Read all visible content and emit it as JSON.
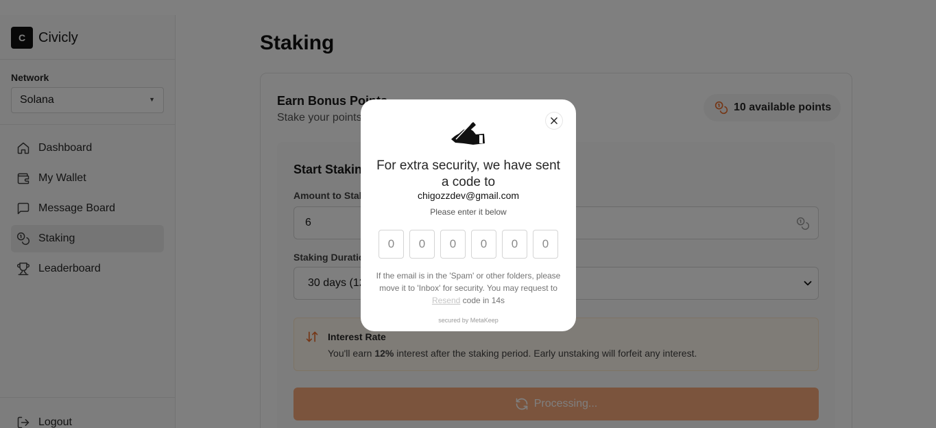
{
  "brand": {
    "logo_letter": "C",
    "name": "Civicly"
  },
  "network": {
    "label": "Network",
    "selected": "Solana"
  },
  "nav": {
    "items": [
      {
        "label": "Dashboard",
        "icon": "home-icon"
      },
      {
        "label": "My Wallet",
        "icon": "wallet-icon"
      },
      {
        "label": "Message Board",
        "icon": "message-icon"
      },
      {
        "label": "Staking",
        "icon": "coins-icon",
        "active": true
      },
      {
        "label": "Leaderboard",
        "icon": "trophy-icon"
      }
    ],
    "logout_label": "Logout"
  },
  "page": {
    "title": "Staking"
  },
  "card": {
    "title": "Earn Bonus Points",
    "subtitle": "Stake your points",
    "points_pill": "10 available points"
  },
  "staking_form": {
    "title": "Start Staking",
    "amount_label": "Amount to Stake",
    "amount_value": "6",
    "duration_label": "Staking Duration",
    "duration_value": "30 days (12",
    "interest_title": "Interest Rate",
    "interest_prefix": "You'll earn ",
    "interest_rate": "12%",
    "interest_suffix": " interest after the staking period. Early unstaking will forfeit any interest.",
    "button_label": "Processing..."
  },
  "modal": {
    "heading": "For extra security, we have sent a code to",
    "email": "chigozzdev@gmail.com",
    "subtext": "Please enter it below",
    "otp_placeholders": [
      "0",
      "0",
      "0",
      "0",
      "0",
      "0"
    ],
    "note_prefix": "If the email is in the 'Spam' or other folders, please move it to 'Inbox' for security. You may request to ",
    "resend_label": "Resend",
    "note_suffix": " code in 14s",
    "secured_by": "secured by MetaKeep"
  },
  "colors": {
    "accent": "#ea6c2b",
    "button_disabled": "#f6a97a",
    "overlay": "rgba(0,0,0,0.5)"
  }
}
